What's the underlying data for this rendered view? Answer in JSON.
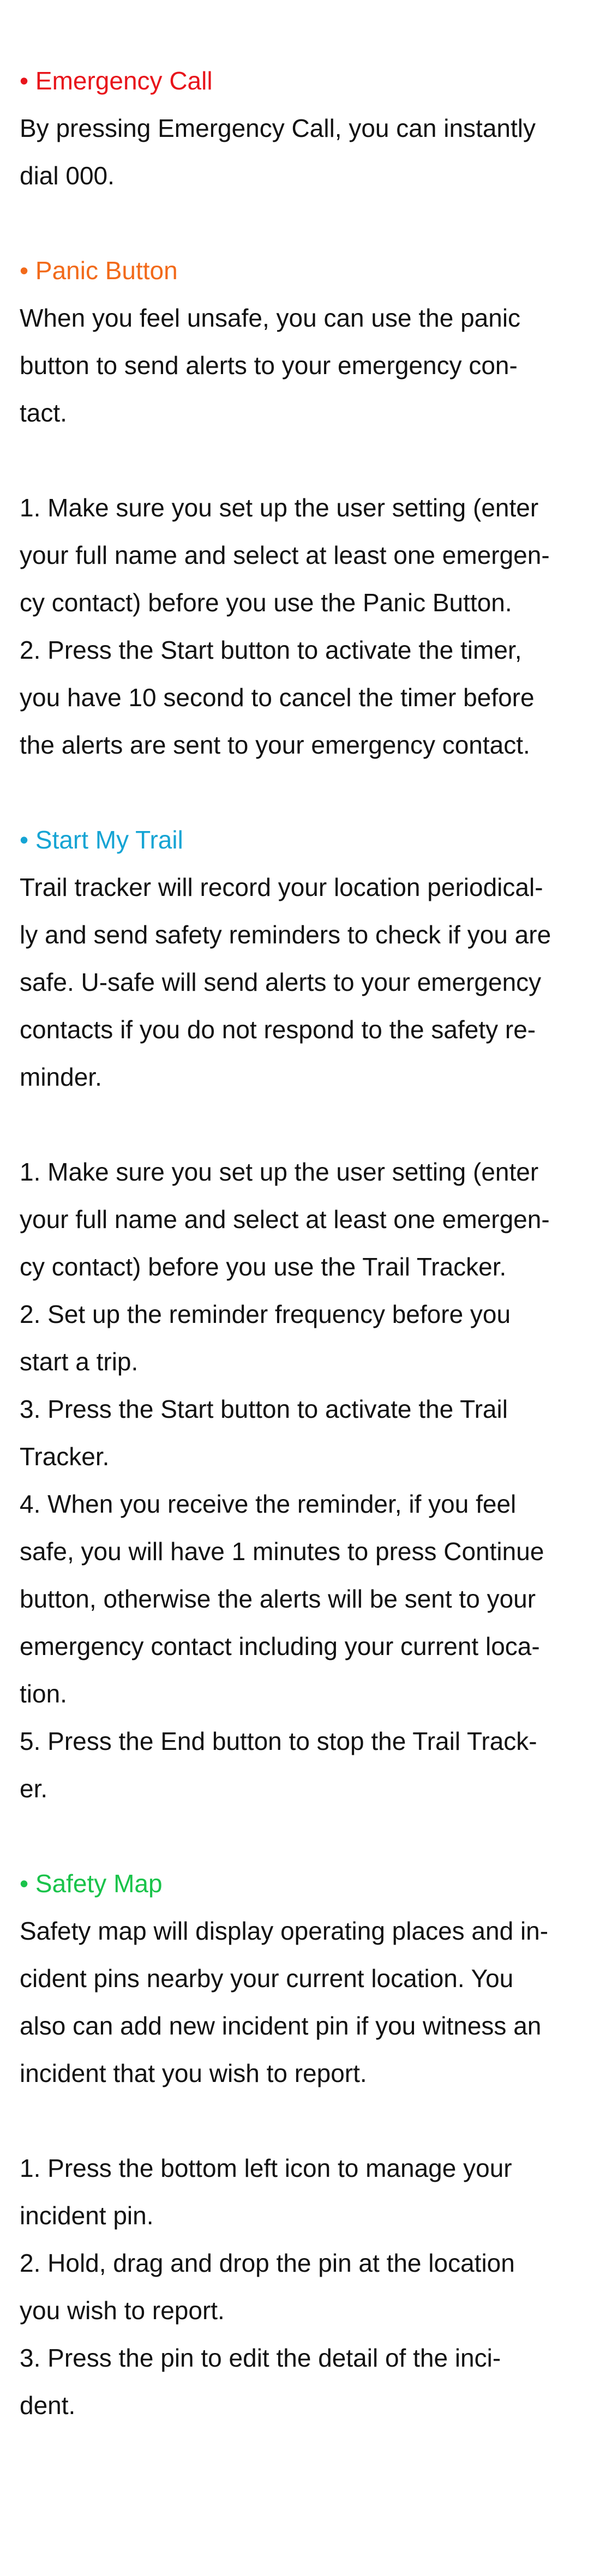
{
  "sections": {
    "emergency_call": {
      "title": "• Emergency Call",
      "lines": [
        "By pressing Emergency Call, you can instantly",
        "dial 000."
      ]
    },
    "panic_button": {
      "title": "• Panic Button",
      "lines": [
        "When you feel unsafe, you can use the panic",
        "button to send alerts to your emergency con-",
        "tact.",
        "",
        "1.  Make sure you set up the user setting (enter",
        "your full name and select at least one emergen-",
        "cy contact) before you use the Panic Button.",
        "2.  Press the Start button to activate the timer,",
        "you have 10 second to cancel the timer before",
        "the alerts are sent to your emergency contact."
      ]
    },
    "start_my_trail": {
      "title": "• Start My Trail",
      "lines": [
        "Trail tracker will record your location periodical-",
        "ly and send safety reminders to check if you are",
        "safe. U-safe will send alerts to your emergency",
        "contacts if you do not respond to the safety re-",
        "minder.",
        "",
        "1.  Make sure you set up the user setting (enter",
        "your full name and select at least one emergen-",
        "cy contact) before you use the Trail Tracker.",
        "2.  Set up the reminder frequency before you",
        "start a trip.",
        "3.  Press the Start button to activate the Trail",
        "Tracker.",
        "4.  When you receive the reminder, if you feel",
        "safe, you will have 1 minutes to press Continue",
        "button, otherwise the alerts will be sent to your",
        "emergency contact including your current loca-",
        "tion.",
        "5.  Press the End button to stop the Trail Track-",
        "er."
      ]
    },
    "safety_map": {
      "title": "• Safety Map",
      "lines": [
        "Safety map will display operating places and in-",
        "cident pins nearby your current location. You",
        "also can add new incident pin if you witness an",
        "incident that you wish to report.",
        "",
        "1.  Press the bottom left icon to manage your",
        "incident pin.",
        "2.  Hold, drag and drop the pin at the location",
        "you wish to report.",
        "3.  Press the pin to edit the detail of the inci-",
        "dent."
      ]
    }
  },
  "colors": {
    "emergency_call": "#e8141b",
    "panic_button": "#f26a1a",
    "start_my_trail": "#15a4d4",
    "safety_map": "#19c34a"
  }
}
